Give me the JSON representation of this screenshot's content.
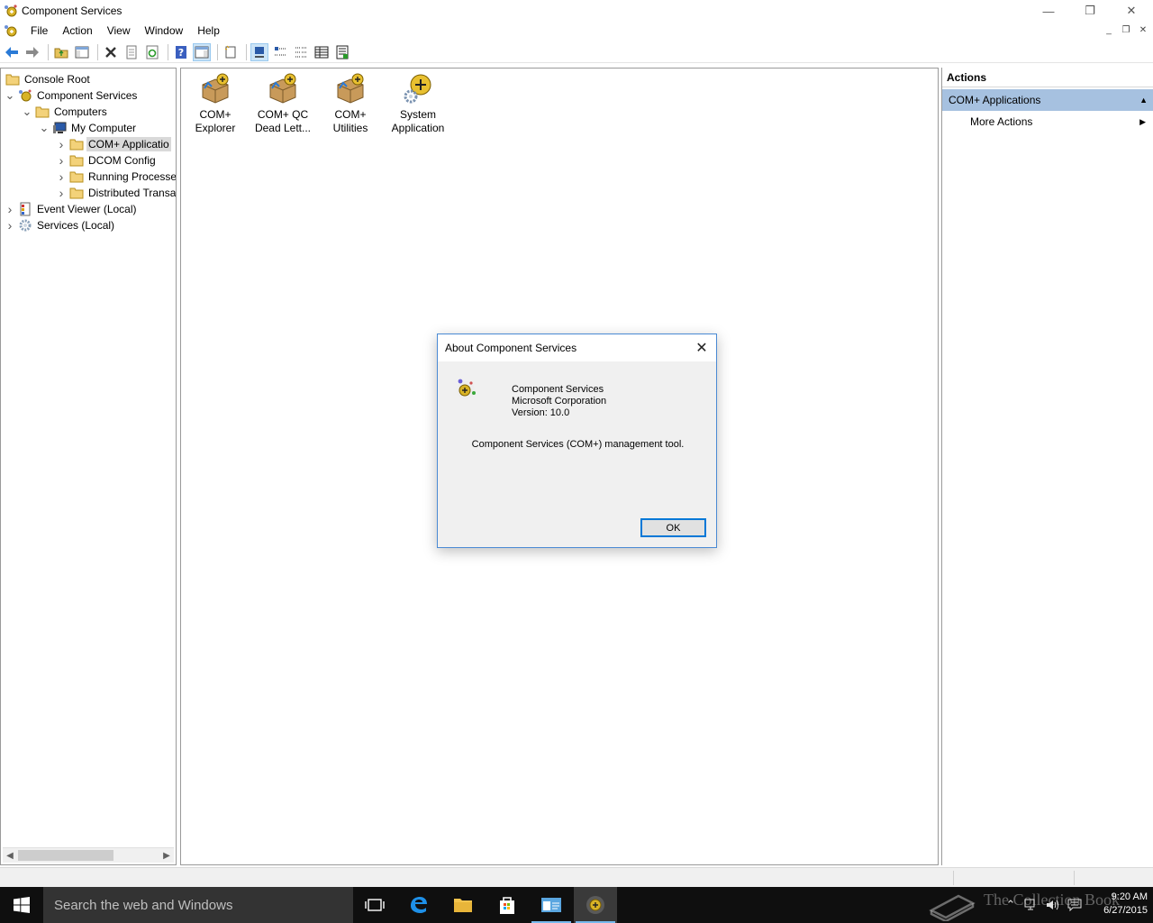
{
  "window": {
    "title": "Component Services",
    "controls": {
      "minimize": "—",
      "restore": "❐",
      "close": "✕"
    }
  },
  "menubar": {
    "items": [
      "File",
      "Action",
      "View",
      "Window",
      "Help"
    ],
    "mdi": {
      "minimize": "_",
      "restore": "❐",
      "close": "✕"
    }
  },
  "toolbar": {
    "buttons": [
      "back-arrow-icon",
      "forward-arrow-icon",
      "up-folder-icon",
      "show-hide-tree-icon",
      "delete-icon",
      "properties-icon",
      "refresh-icon",
      "help-icon",
      "show-hide-action-pane-icon",
      "new-window-icon",
      "large-icons-view-icon",
      "small-icons-view-icon",
      "list-view-icon",
      "detail-view-icon",
      "export-list-icon"
    ]
  },
  "tree": {
    "items": [
      {
        "label": "Console Root",
        "expander": "",
        "icon": "folder-icon"
      },
      {
        "label": "Component Services",
        "expander": "expanded",
        "icon": "component-services-icon"
      },
      {
        "label": "Computers",
        "expander": "expanded",
        "icon": "folder-icon"
      },
      {
        "label": "My Computer",
        "expander": "expanded",
        "icon": "computer-icon"
      },
      {
        "label": "COM+ Applicatio",
        "expander": "collapsed",
        "icon": "folder-icon",
        "selected": true
      },
      {
        "label": "DCOM Config",
        "expander": "collapsed",
        "icon": "folder-icon"
      },
      {
        "label": "Running Processe",
        "expander": "collapsed",
        "icon": "folder-icon"
      },
      {
        "label": "Distributed Transa",
        "expander": "collapsed",
        "icon": "folder-icon"
      },
      {
        "label": "Event Viewer (Local)",
        "expander": "collapsed",
        "icon": "event-viewer-icon"
      },
      {
        "label": "Services (Local)",
        "expander": "collapsed",
        "icon": "services-gear-icon"
      }
    ]
  },
  "center": {
    "items": [
      {
        "line1": "COM+",
        "line2": "Explorer",
        "icon": "com-package-icon"
      },
      {
        "line1": "COM+ QC",
        "line2": "Dead Lett...",
        "icon": "com-package-icon"
      },
      {
        "line1": "COM+",
        "line2": "Utilities",
        "icon": "com-package-icon"
      },
      {
        "line1": "System",
        "line2": "Application",
        "icon": "system-application-icon"
      }
    ]
  },
  "actions": {
    "header": "Actions",
    "section": "COM+ Applications",
    "rows": [
      "More Actions"
    ]
  },
  "dialog": {
    "title": "About Component Services",
    "product": "Component Services",
    "company": "Microsoft Corporation",
    "version": "Version: 10.0",
    "description": "Component Services (COM+) management tool.",
    "ok_label": "OK"
  },
  "taskbar": {
    "search_placeholder": "Search the web and Windows",
    "time": "9:20 AM",
    "date": "6/27/2015",
    "watermark": "The Collection Book"
  },
  "colors": {
    "selection": "#a6c1e0",
    "dialog_border": "#4a8ad4",
    "taskbar": "#0f0f0f",
    "accent": "#0078d7"
  }
}
